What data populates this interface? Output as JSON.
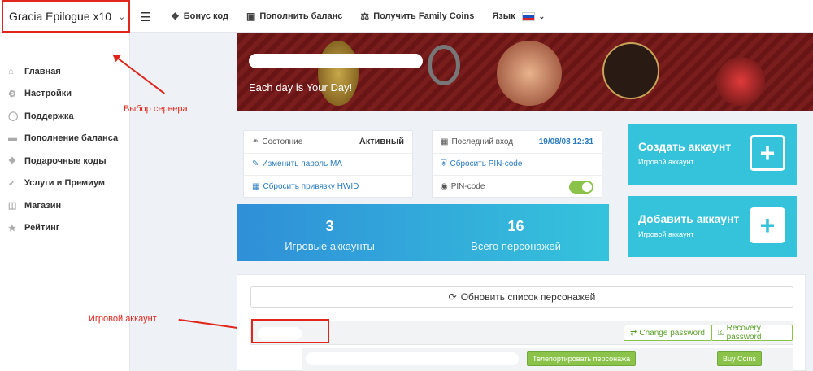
{
  "topbar": {
    "server": "Gracia Epilogue x10",
    "nav": [
      {
        "icon": "gift-icon",
        "label": "Бонус код"
      },
      {
        "icon": "wallet-icon",
        "label": "Пополнить баланс"
      },
      {
        "icon": "coins-icon",
        "label": "Получить Family Coins"
      }
    ],
    "language_label": "Язык"
  },
  "sidebar": {
    "items": [
      {
        "icon": "home-icon",
        "label": "Главная"
      },
      {
        "icon": "gear-icon",
        "label": "Настройки"
      },
      {
        "icon": "lifebuoy-icon",
        "label": "Поддержка"
      },
      {
        "icon": "card-icon",
        "label": "Пополнение баланса"
      },
      {
        "icon": "gift-icon",
        "label": "Подарочные коды"
      },
      {
        "icon": "cart-icon",
        "label": "Услуги и Премиум"
      },
      {
        "icon": "basket-icon",
        "label": "Магазин"
      },
      {
        "icon": "star-icon",
        "label": "Рейтинг"
      }
    ]
  },
  "annotations": {
    "server_note": "Выбор сервера",
    "account_note": "Игровой аккаунт"
  },
  "banner": {
    "slogan": "Each day is Your Day!"
  },
  "account_info": {
    "status_label": "Состояние",
    "status_value": "Активный",
    "change_password": "Изменить пароль МА",
    "reset_hwid": "Сбросить привязку HWID",
    "last_login_label": "Последний вход",
    "last_login_value": "19/08/08 12:31",
    "reset_pin": "Сбросить PIN-code",
    "pin_label": "PIN-code",
    "pin_enabled": true
  },
  "stats": {
    "accounts_count": "3",
    "accounts_label": "Игровые аккаунты",
    "chars_count": "16",
    "chars_label": "Всего персонажей"
  },
  "cards": {
    "create_title": "Создать аккаунт",
    "create_sub": "Игровой аккаунт",
    "add_title": "Добавить аккаунт",
    "add_sub": "Игровой аккаунт"
  },
  "characters": {
    "refresh_label": "Обновить список персонажей",
    "change_password": "Change password",
    "recovery_password": "Recovery password",
    "teleport": "Телепортировать персонажа",
    "buy_coins": "Buy Coins"
  },
  "colors": {
    "accent": "#35c3dc",
    "annotation": "#e0261c",
    "success": "#8bc34a"
  }
}
